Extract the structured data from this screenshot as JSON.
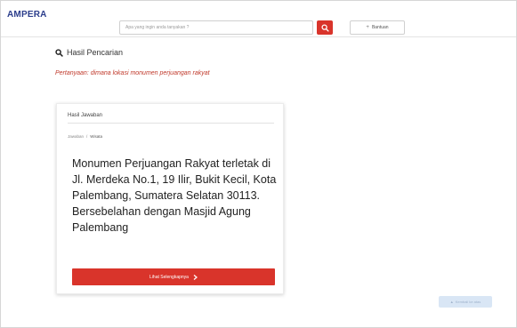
{
  "header": {
    "logo": "AMPERA",
    "search_placeholder": "Apa yang ingin anda tanyakan ?",
    "help_label": "Bantuan"
  },
  "results": {
    "title": "Hasil Pencarian",
    "question": "Pertanyaan: dimana lokasi monumen perjuangan rakyat"
  },
  "card": {
    "header": "Hasil Jawaban",
    "breadcrumb": [
      "Jawaban",
      "Wisata"
    ],
    "answer": "Monumen Perjuangan Rakyat terletak di Jl. Merdeka No.1, 19 Ilir, Bukit Kecil, Kota Palembang, Sumatera Selatan 30113. Bersebelahan dengan Masjid Agung Palembang",
    "detail_label": "Lihat Selengkapnya"
  },
  "corner_button_label": "Kembali ke atas",
  "colors": {
    "accent": "#d9342b",
    "brand": "#2c3e8c"
  },
  "icons": {
    "search": "search-icon",
    "help": "plus-icon",
    "result": "search-icon",
    "detail": "chevron-right-icon"
  }
}
